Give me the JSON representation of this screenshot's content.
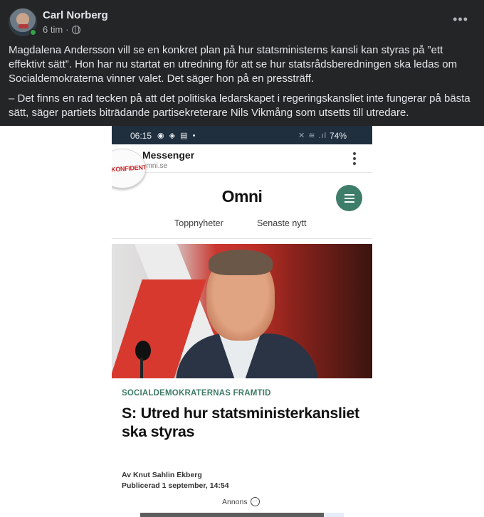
{
  "post": {
    "author": "Carl Norberg",
    "time": "6 tim",
    "separator": "·",
    "paragraph1": "Magdalena Andersson vill se en konkret plan på hur statsministerns kansli kan styras på ”ett effektivt sätt”. Hon har nu startat en utredning för att se hur statsrådsberedningen ska ledas om Socialdemokraterna vinner valet. Det säger hon på en pressträff.",
    "paragraph2": "– Det finns en rad tecken på att det politiska ledarskapet i regeringskansliet inte fungerar på bästa sätt, säger partiets biträdande partisekreterare Nils Vikmång som utsetts till utredare."
  },
  "screenshot": {
    "statusbar": {
      "time": "06:15",
      "battery": "74%"
    },
    "messenger": {
      "title": "Messenger",
      "url": "omni.se"
    },
    "sticker": "KONFIDENTIELLT",
    "site": {
      "logo": "Omni",
      "tabs": [
        "Toppnyheter",
        "Senaste nytt"
      ]
    },
    "article": {
      "kicker": "SOCIALDEMOKRATERNAS FRAMTID",
      "headline": "S: Utred hur statsministerkansliet ska styras",
      "author": "Av Knut Sahlin Ekberg",
      "published": "Publicerad 1 september, 14:54",
      "ad_label": "Annons"
    }
  },
  "colors": {
    "fb_bg": "#242526",
    "omni_green": "#3f7d6b",
    "online": "#31a24c"
  },
  "icons": [
    "globe-icon",
    "more-icon",
    "kebab-icon",
    "menu-icon",
    "dots-icon"
  ]
}
